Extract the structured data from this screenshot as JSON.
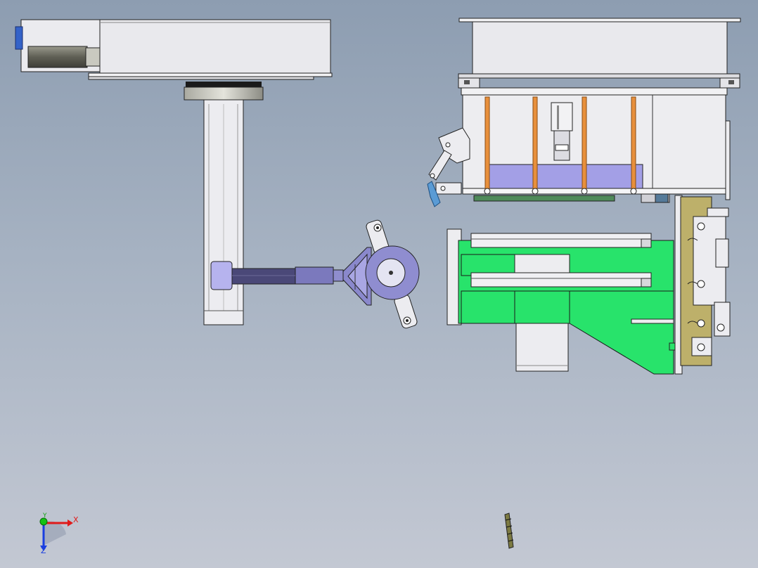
{
  "viewport": {
    "background_top": "#8d9db1",
    "background_bottom": "#c3c8d3"
  },
  "colors": {
    "panel": "#e6e6ea",
    "panel_edge": "#2a2a2a",
    "green_block": "#28e36b",
    "lavender": "#9e98df",
    "slate_arm": "#7a78b8",
    "orange_strap": "#e8903c",
    "olive_plate": "#bdb06a",
    "dark_green_strip": "#4f8a5a",
    "blue_clip": "#5a9bd5"
  },
  "triad": {
    "x_label": "X",
    "y_label": "Y",
    "z_label": "Z",
    "x_color": "#e01a1a",
    "y_color": "#13a313",
    "z_color": "#1a3ee0"
  }
}
